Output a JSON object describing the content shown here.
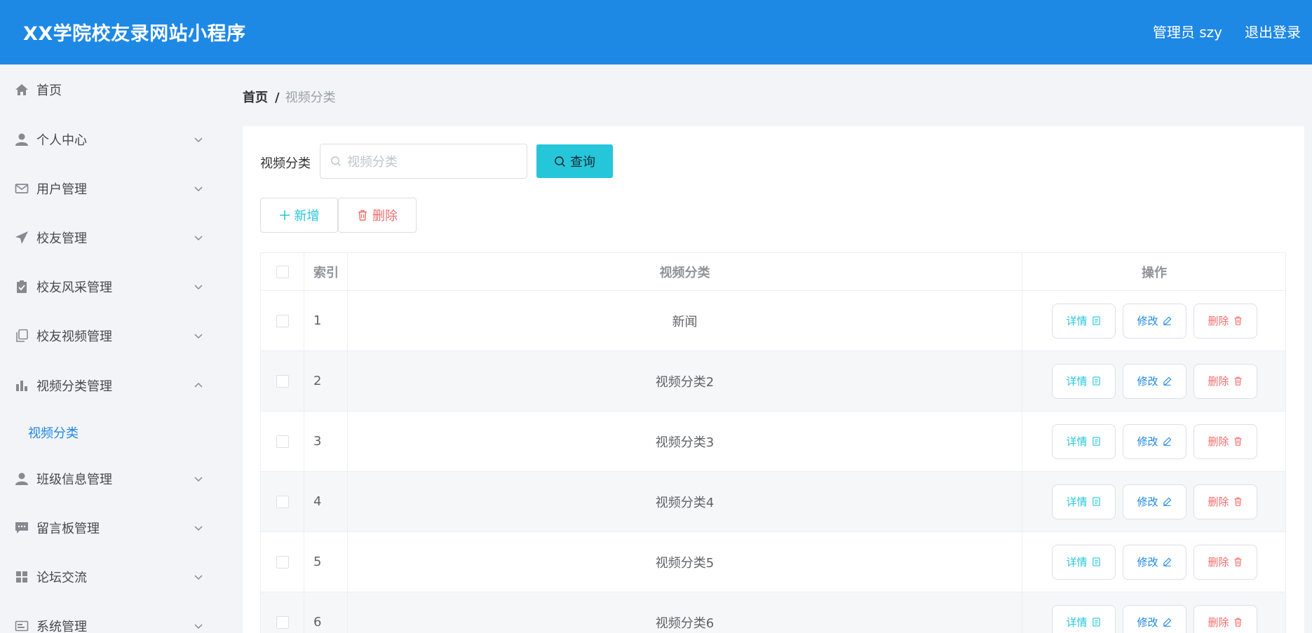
{
  "header": {
    "title": "XX学院校友录网站小程序",
    "admin": "管理员 szy",
    "logout": "退出登录"
  },
  "sidebar": {
    "items": [
      {
        "label": "首页",
        "icon": "home-icon"
      },
      {
        "label": "个人中心",
        "icon": "user-icon"
      },
      {
        "label": "用户管理",
        "icon": "mail-icon"
      },
      {
        "label": "校友管理",
        "icon": "send-icon"
      },
      {
        "label": "校友风采管理",
        "icon": "clipboard-icon"
      },
      {
        "label": "校友视频管理",
        "icon": "copy-icon"
      },
      {
        "label": "视频分类管理",
        "icon": "bar-chart-icon"
      },
      {
        "label": "班级信息管理",
        "icon": "user-icon"
      },
      {
        "label": "留言板管理",
        "icon": "message-icon"
      },
      {
        "label": "论坛交流",
        "icon": "grid-icon"
      },
      {
        "label": "系统管理",
        "icon": "system-icon"
      }
    ],
    "active_sub": "视频分类"
  },
  "breadcrumb": {
    "home": "首页",
    "separator": "/",
    "current": "视频分类"
  },
  "search": {
    "label": "视频分类",
    "placeholder": "视频分类",
    "button": "查询"
  },
  "actions": {
    "add": "新增",
    "delete": "删除"
  },
  "table": {
    "headers": {
      "index": "索引",
      "category": "视频分类",
      "ops": "操作"
    },
    "rows": [
      {
        "index": "1",
        "category": "新闻"
      },
      {
        "index": "2",
        "category": "视频分类2"
      },
      {
        "index": "3",
        "category": "视频分类3"
      },
      {
        "index": "4",
        "category": "视频分类4"
      },
      {
        "index": "5",
        "category": "视频分类5"
      },
      {
        "index": "6",
        "category": "视频分类6"
      }
    ],
    "ops": {
      "detail": "详情",
      "edit": "修改",
      "delete": "删除"
    }
  },
  "colors": {
    "header_bg": "#1e88e5",
    "accent_cyan": "#26c6da",
    "danger": "#f56c6c"
  }
}
